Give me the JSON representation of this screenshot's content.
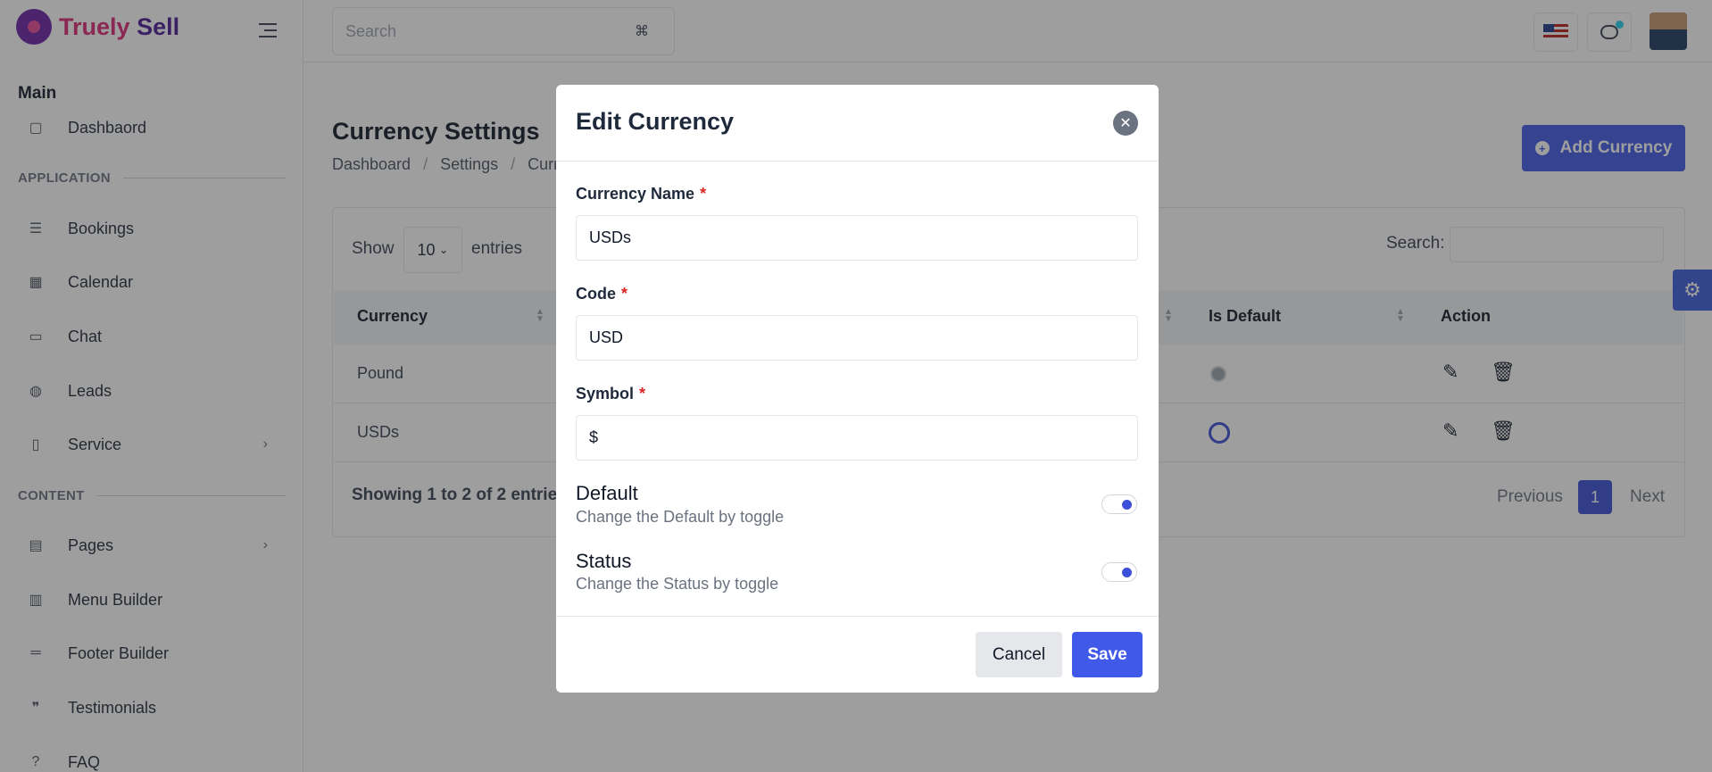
{
  "app": {
    "brand_part1": "Truely",
    "brand_part2": "Sell"
  },
  "sidebar": {
    "main_heading": "Main",
    "dashboard_label": "Dashbaord",
    "section_application": "APPLICATION",
    "application_items": [
      {
        "label": "Bookings",
        "icon": "list-icon"
      },
      {
        "label": "Calendar",
        "icon": "calendar-icon"
      },
      {
        "label": "Chat",
        "icon": "chat-icon"
      },
      {
        "label": "Leads",
        "icon": "globe-icon"
      },
      {
        "label": "Service",
        "icon": "book-icon"
      }
    ],
    "section_content": "CONTENT",
    "content_items": [
      {
        "label": "Pages",
        "icon": "pages-icon"
      },
      {
        "label": "Menu Builder",
        "icon": "menu-icon"
      },
      {
        "label": "Footer Builder",
        "icon": "footer-icon"
      },
      {
        "label": "Testimonials",
        "icon": "quote-icon"
      },
      {
        "label": "FAQ",
        "icon": "help-icon"
      }
    ]
  },
  "header": {
    "search_placeholder": "Search",
    "search_shortcut": "⌘"
  },
  "main": {
    "title": "Currency Settings",
    "breadcrumb": [
      "Dashboard",
      "Settings",
      "Curr"
    ],
    "add_button": "Add Currency",
    "show_label": "Show",
    "entries_value": "10",
    "entries_label": "entries",
    "search_label": "Search:",
    "columns": {
      "currency": "Currency",
      "is_default": "Is Default",
      "action": "Action"
    },
    "rows": [
      {
        "currency": "Pound",
        "is_default": false
      },
      {
        "currency": "USDs",
        "is_default": true
      }
    ],
    "showing": "Showing 1 to 2 of 2 entrie",
    "pagination": {
      "previous": "Previous",
      "current": "1",
      "next": "Next"
    }
  },
  "modal": {
    "title": "Edit Currency",
    "close": "✕",
    "currency_name_label": "Currency Name",
    "currency_name_value": "USDs",
    "code_label": "Code",
    "code_value": "USD",
    "symbol_label": "Symbol",
    "symbol_value": "$",
    "required_mark": "*",
    "default_title": "Default",
    "default_desc": "Change the Default by toggle",
    "default_on": true,
    "status_title": "Status",
    "status_desc": "Change the Status by toggle",
    "status_on": true,
    "cancel_label": "Cancel",
    "save_label": "Save"
  },
  "colors": {
    "primary": "#4059e8",
    "overlay": "rgba(40,40,40,0.45)"
  }
}
